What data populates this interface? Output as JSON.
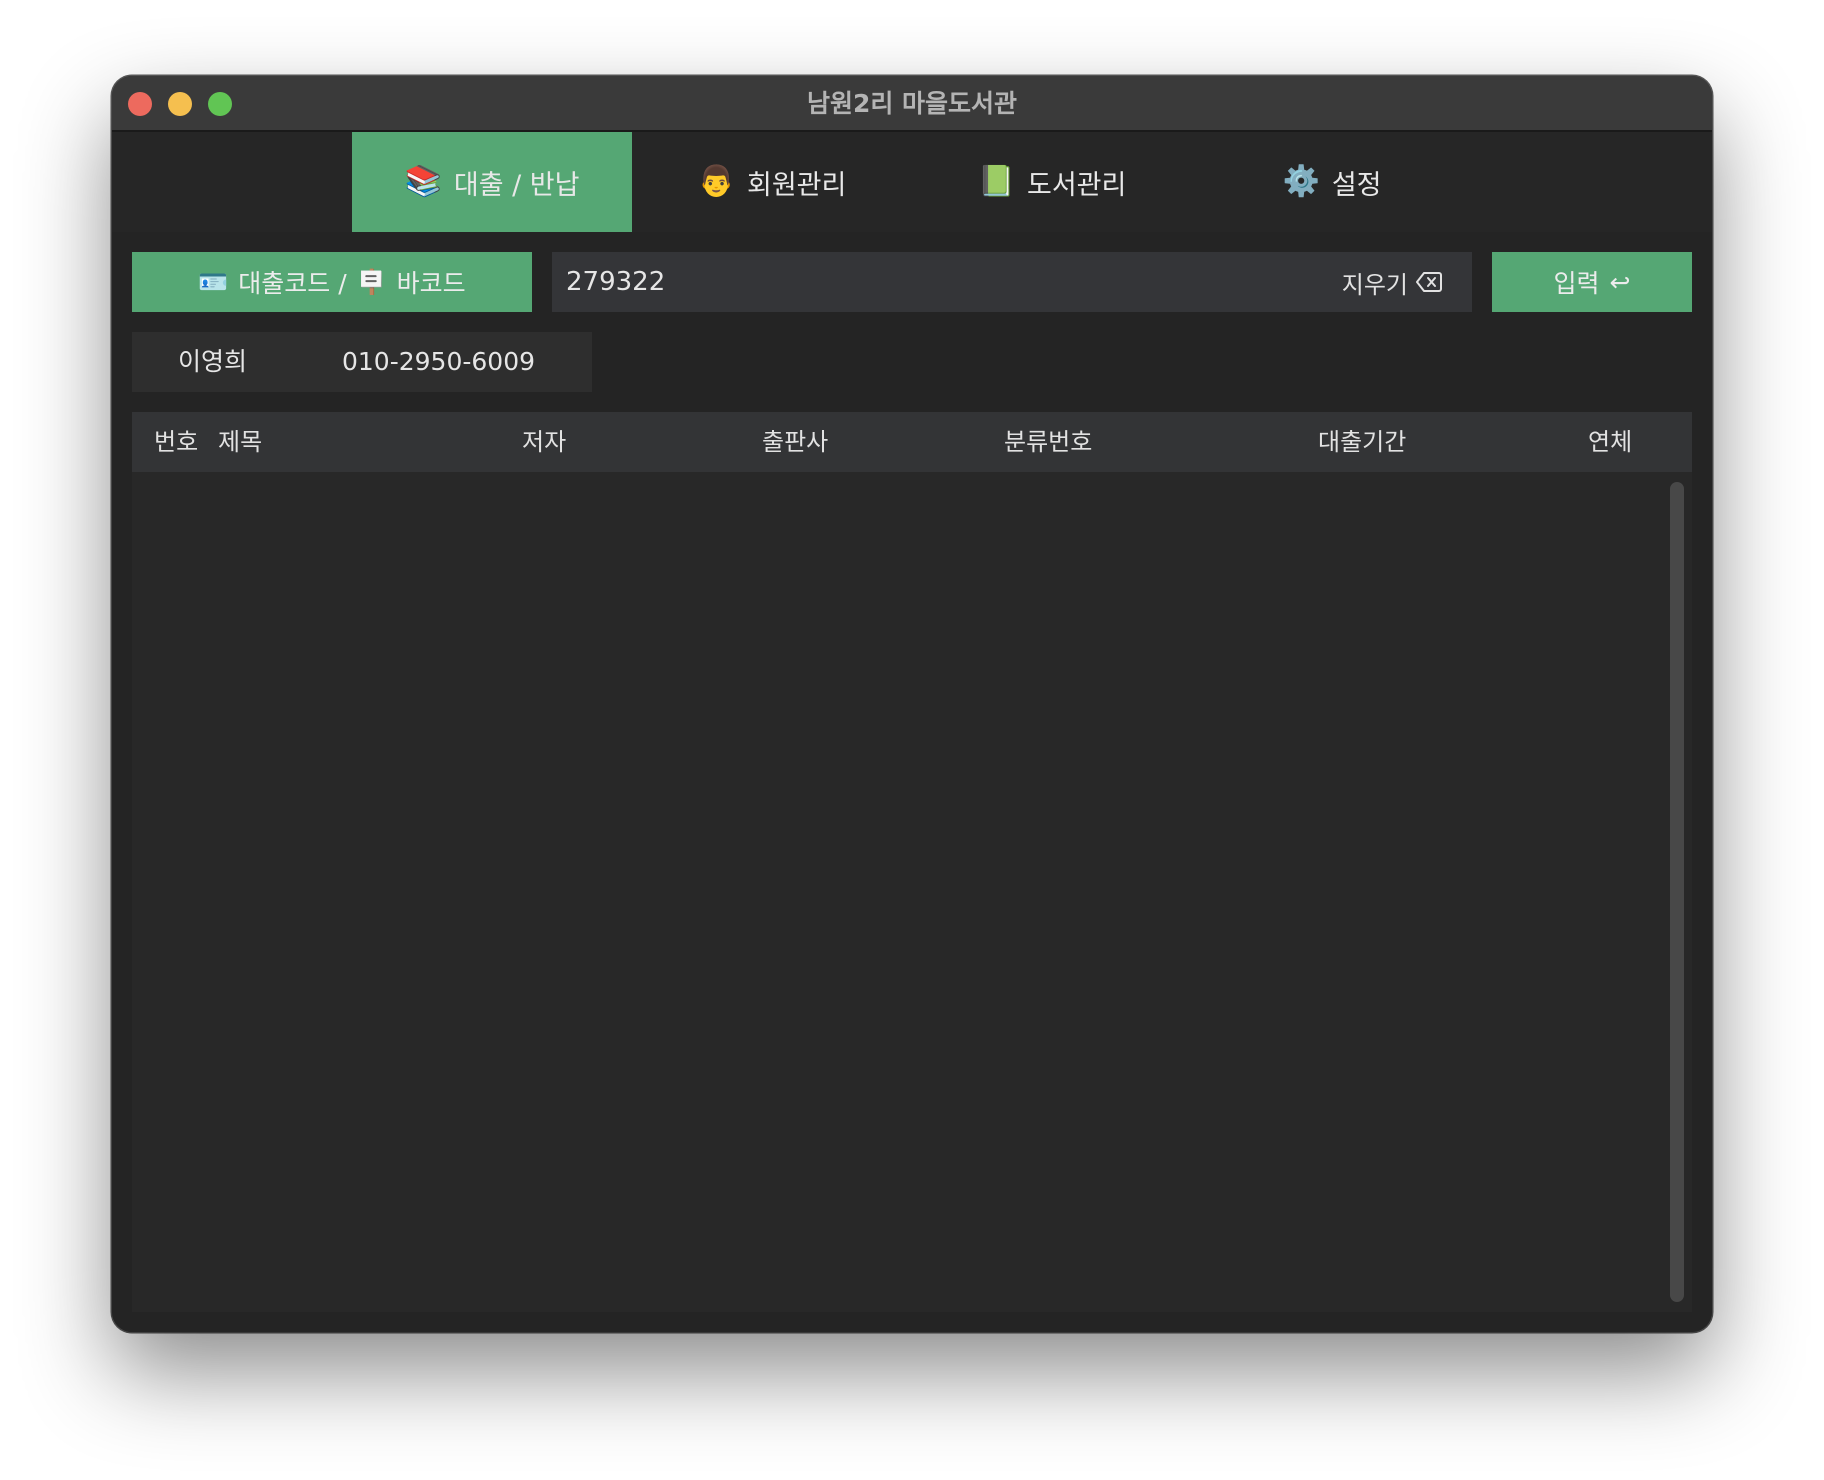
{
  "window": {
    "title": "남원2리 마을도서관"
  },
  "tabs": [
    {
      "icon": "📚",
      "icon_name": "books-icon",
      "label": "대출 / 반납",
      "active": true
    },
    {
      "icon": "👨",
      "icon_name": "person-icon",
      "label": "회원관리",
      "active": false
    },
    {
      "icon": "📗",
      "icon_name": "green-book-icon",
      "label": "도서관리",
      "active": false
    },
    {
      "icon": "⚙️",
      "icon_name": "gear-icon",
      "label": "설정",
      "active": false
    }
  ],
  "toolbar": {
    "code_button": {
      "icon1": "🪪",
      "text1": "대출코드 /",
      "icon2": "🪧",
      "text2": "바코드"
    },
    "input_value": "279322",
    "clear_label": "지우기",
    "enter_label": "입력",
    "enter_icon": "↩"
  },
  "member": {
    "name": "이영희",
    "phone": "010-2950-6009"
  },
  "table": {
    "columns": [
      "번호",
      "제목",
      "저자",
      "출판사",
      "분류번호",
      "대출기간",
      "연체"
    ],
    "rows": []
  },
  "colors": {
    "accent": "#55a774",
    "background": "#242424",
    "titlebar": "#3a3a3a"
  }
}
